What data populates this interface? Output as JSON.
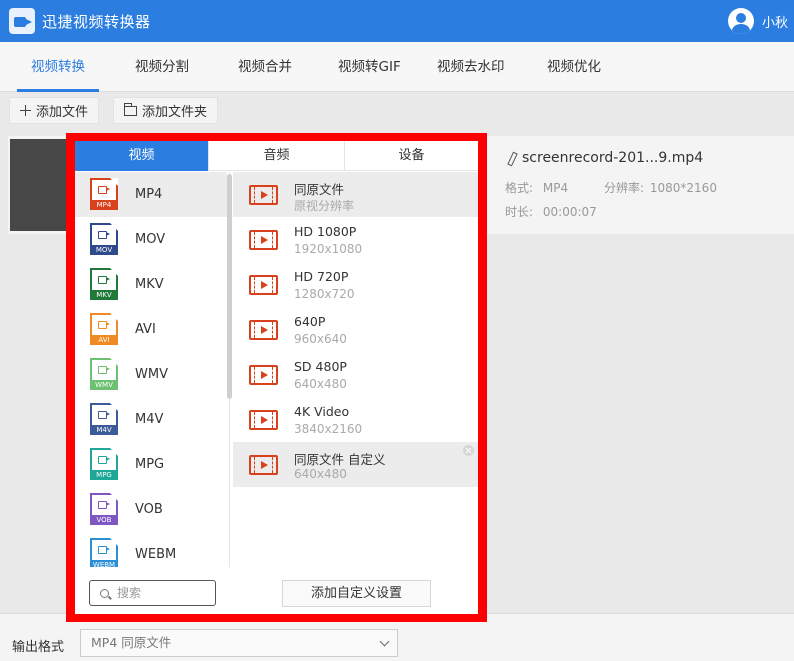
{
  "app": {
    "title": "迅捷视频转换器",
    "user": "小秋"
  },
  "tabs": [
    {
      "label": "视频转换"
    },
    {
      "label": "视频分割"
    },
    {
      "label": "视频合并"
    },
    {
      "label": "视频转GIF"
    },
    {
      "label": "视频去水印"
    },
    {
      "label": "视频优化"
    }
  ],
  "toolbar": {
    "add_file": "添加文件",
    "add_folder": "添加文件夹"
  },
  "file": {
    "name": "screenrecord-201...9.mp4",
    "format_label": "格式:",
    "format_value": "MP4",
    "resolution_label": "分辨率:",
    "resolution_value": "1080*2160",
    "duration_label": "时长:",
    "duration_value": "00:00:07"
  },
  "popup": {
    "tabs": [
      {
        "label": "视频"
      },
      {
        "label": "音频"
      },
      {
        "label": "设备"
      }
    ],
    "formats": [
      {
        "label": "MP4",
        "color": "#d9401c"
      },
      {
        "label": "MOV",
        "color": "#2f4a8a"
      },
      {
        "label": "MKV",
        "color": "#1f7a3a"
      },
      {
        "label": "AVI",
        "color": "#f08a24"
      },
      {
        "label": "WMV",
        "color": "#6cc070"
      },
      {
        "label": "M4V",
        "color": "#3d5a99"
      },
      {
        "label": "MPG",
        "color": "#1fa89a"
      },
      {
        "label": "VOB",
        "color": "#7e57c2"
      },
      {
        "label": "WEBM",
        "color": "#2b8fd6"
      }
    ],
    "resolutions": [
      {
        "title": "同原文件",
        "sub": "原视分辨率"
      },
      {
        "title": "HD 1080P",
        "sub": "1920x1080"
      },
      {
        "title": "HD 720P",
        "sub": "1280x720"
      },
      {
        "title": "640P",
        "sub": "960x640"
      },
      {
        "title": "SD 480P",
        "sub": "640x480"
      },
      {
        "title": "4K Video",
        "sub": "3840x2160"
      },
      {
        "title": "同原文件 自定义",
        "sub": "640x480"
      }
    ],
    "search_placeholder": "搜索",
    "custom_button": "添加自定义设置"
  },
  "output": {
    "label": "输出格式",
    "value": "MP4  同原文件"
  }
}
